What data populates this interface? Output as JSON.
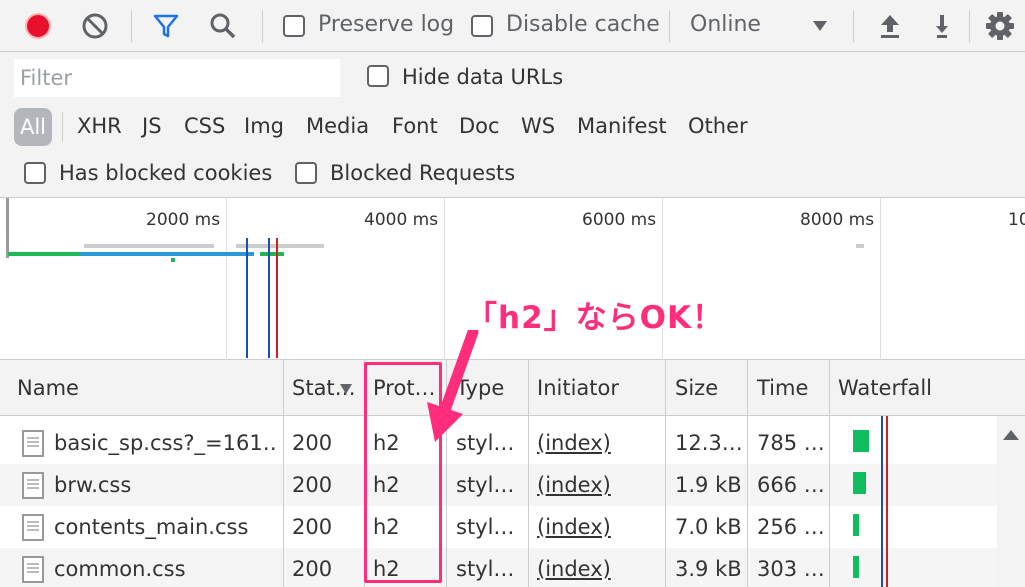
{
  "toolbar": {
    "preserve_log_label": "Preserve log",
    "disable_cache_label": "Disable cache",
    "throttle_value": "Online"
  },
  "filterbar": {
    "filter_placeholder": "Filter",
    "hide_data_urls_label": "Hide data URLs",
    "types": [
      "All",
      "XHR",
      "JS",
      "CSS",
      "Img",
      "Media",
      "Font",
      "Doc",
      "WS",
      "Manifest",
      "Other"
    ],
    "has_blocked_cookies_label": "Has blocked cookies",
    "blocked_requests_label": "Blocked Requests"
  },
  "overview": {
    "ticks": [
      "2000 ms",
      "4000 ms",
      "6000 ms",
      "8000 ms",
      "10"
    ]
  },
  "annotation": {
    "text": "「h2」ならOK！",
    "color": "#ff2d7c"
  },
  "table": {
    "headers": [
      "Name",
      "Stat…",
      "Prot…",
      "Type",
      "Initiator",
      "Size",
      "Time",
      "Waterfall"
    ],
    "rows": [
      {
        "name": "basic_sp.css?_=161…",
        "status": "200",
        "protocol": "h2",
        "type": "styl…",
        "initiator": "(index)",
        "size": "12.3…",
        "time": "785 …"
      },
      {
        "name": "brw.css",
        "status": "200",
        "protocol": "h2",
        "type": "styl…",
        "initiator": "(index)",
        "size": "1.9 kB",
        "time": "666 …"
      },
      {
        "name": "contents_main.css",
        "status": "200",
        "protocol": "h2",
        "type": "styl…",
        "initiator": "(index)",
        "size": "7.0 kB",
        "time": "256 …"
      },
      {
        "name": "common.css",
        "status": "200",
        "protocol": "h2",
        "type": "styl…",
        "initiator": "(index)",
        "size": "3.9 kB",
        "time": "303 …"
      }
    ]
  },
  "colors": {
    "record": "#e8112d",
    "filter_active": "#1a73e8",
    "waterfall_bar": "#0fbd5f",
    "highlight": "#ff2d7c"
  }
}
